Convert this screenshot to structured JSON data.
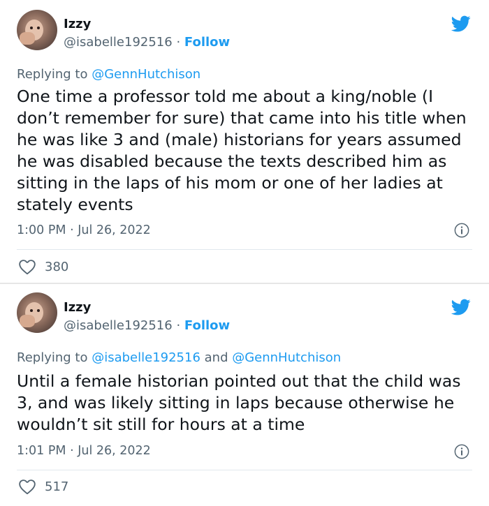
{
  "colors": {
    "accent": "#1d9bf0",
    "muted": "#536471",
    "text": "#0f1419"
  },
  "tweets": [
    {
      "author_name": "Izzy",
      "handle": "@isabelle192516",
      "separator": "·",
      "follow_label": "Follow",
      "reply_prefix": "Replying to ",
      "reply_to_1": "@GennHutchison",
      "reply_joiner": "",
      "reply_to_2": "",
      "text": "One time a professor told me about a king/noble (I don’t remember for sure) that came into his title when he was like 3 and (male) historians for years assumed he was disabled because the texts described him as sitting in the laps of his mom or one of her ladies at stately events",
      "timestamp": "1:00 PM · Jul 26, 2022",
      "likes": "380",
      "icons": [
        "avatar",
        "twitter-bird-icon",
        "info-icon",
        "heart-icon"
      ]
    },
    {
      "author_name": "Izzy",
      "handle": "@isabelle192516",
      "separator": "·",
      "follow_label": "Follow",
      "reply_prefix": "Replying to ",
      "reply_to_1": "@isabelle192516",
      "reply_joiner": " and ",
      "reply_to_2": "@GennHutchison",
      "text": "Until a female historian pointed out that the child was 3, and was likely sitting in laps because otherwise he wouldn’t sit still for hours at a time",
      "timestamp": "1:01 PM · Jul 26, 2022",
      "likes": "517",
      "icons": [
        "avatar",
        "twitter-bird-icon",
        "info-icon",
        "heart-icon"
      ]
    }
  ]
}
